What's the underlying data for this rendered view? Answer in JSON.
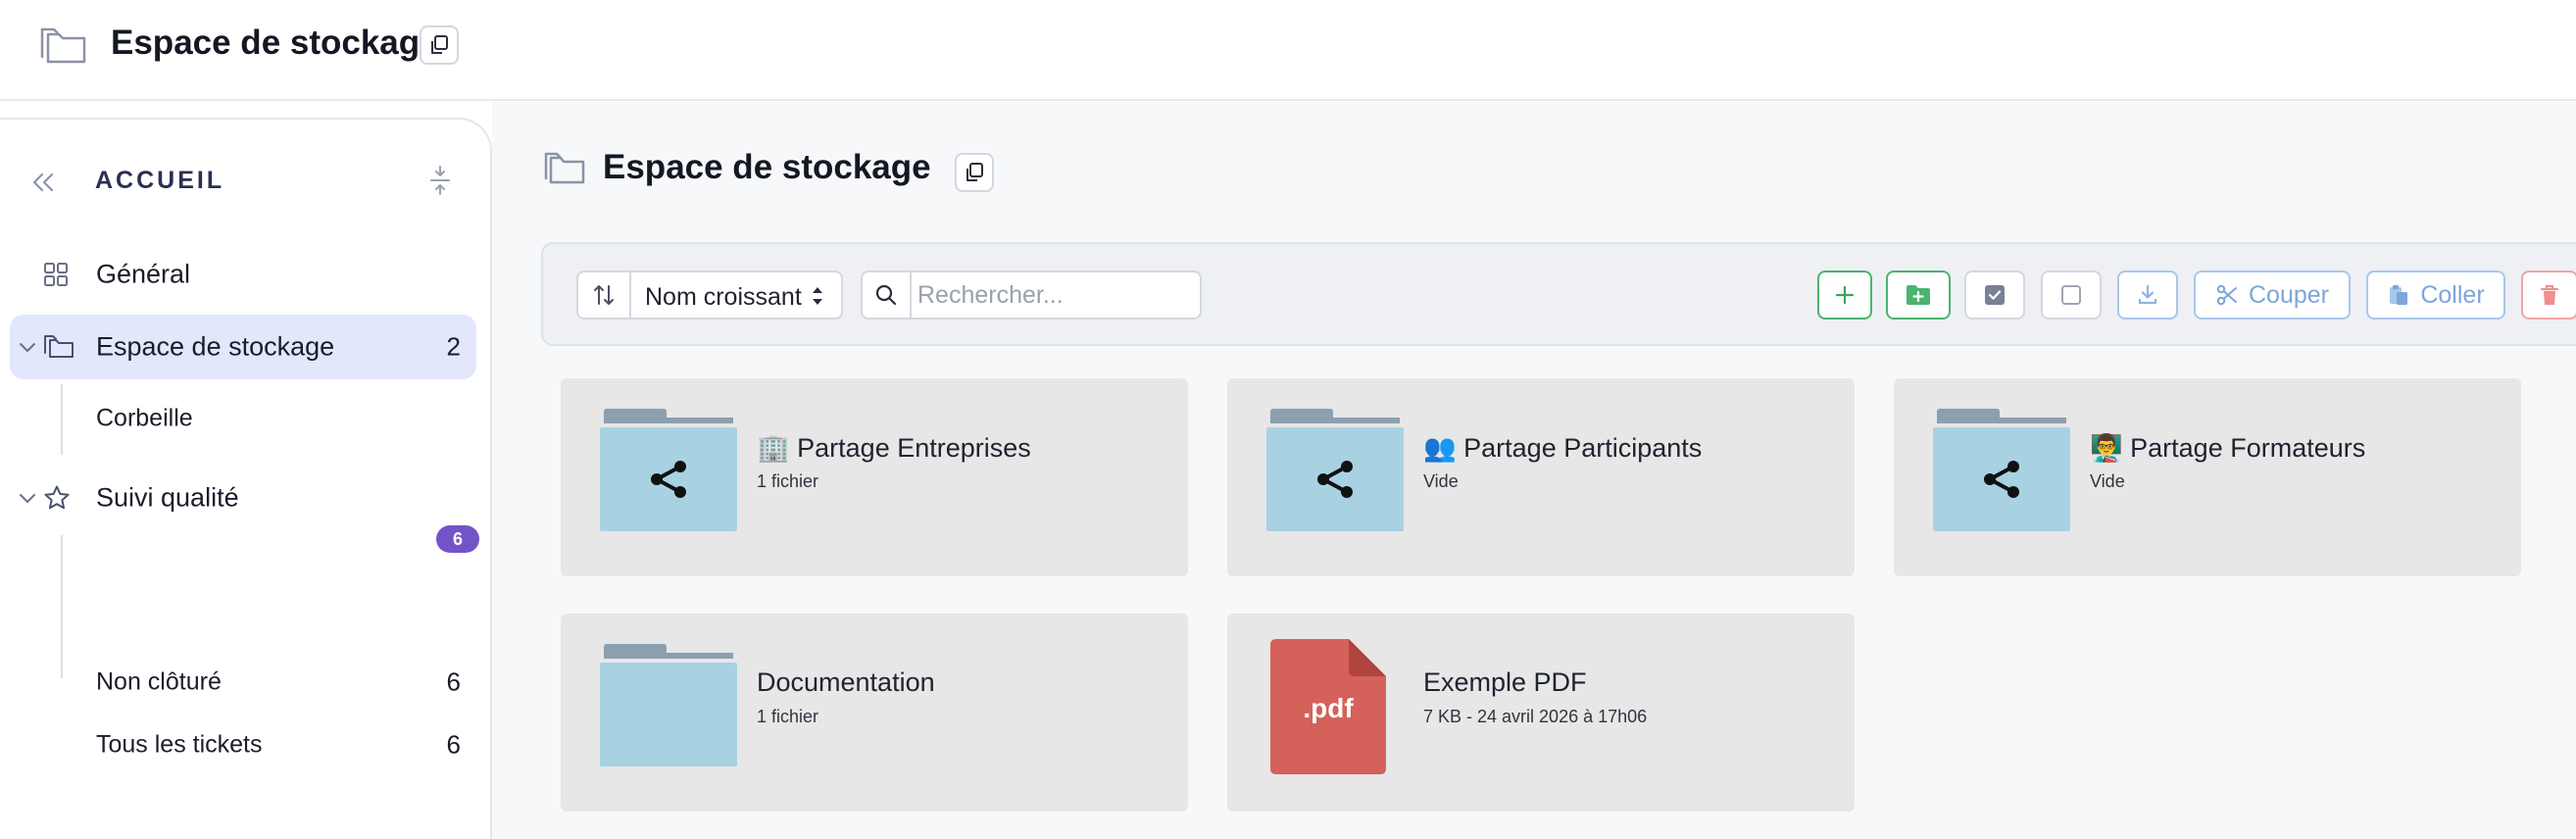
{
  "header": {
    "title": "Espace de stockage"
  },
  "sidebar": {
    "section_title": "ACCUEIL",
    "items": [
      {
        "label": "Général",
        "icon": "grid-icon"
      },
      {
        "label": "Espace de stockage",
        "icon": "folder-icon",
        "count": "2",
        "expanded": true,
        "active": true
      },
      {
        "label": "Corbeille"
      },
      {
        "label": "Suivi qualité",
        "icon": "star-icon",
        "expanded": true
      },
      {
        "label": "Non clôturé",
        "count": "6",
        "badge": "6"
      },
      {
        "label": "Tous les tickets",
        "count": "6"
      }
    ]
  },
  "main": {
    "title": "Espace de stockage",
    "toolbar": {
      "sort_value": "Nom croissant",
      "search_placeholder": "Rechercher...",
      "cut_label": "Couper",
      "paste_label": "Coller"
    },
    "cards": [
      {
        "emoji": "🏢",
        "name": "Partage Entreprises",
        "meta": "1 fichier",
        "type": "shared-folder"
      },
      {
        "emoji": "👥",
        "name": "Partage Participants",
        "meta": "Vide",
        "type": "shared-folder"
      },
      {
        "emoji": "👨‍🏫",
        "name": "Partage Formateurs",
        "meta": "Vide",
        "type": "shared-folder"
      },
      {
        "name": "Documentation",
        "meta": "1 fichier",
        "type": "folder"
      },
      {
        "name": "Exemple PDF",
        "meta": "7 KB - 24 avril 2026 à 17h06",
        "type": "pdf",
        "ext_label": ".pdf"
      }
    ]
  },
  "colors": {
    "accent_purple": "#7353c8",
    "active_bg": "#e2e7fc",
    "folder_body": "#a8d2e2",
    "folder_tab": "#8a9eae",
    "pdf_red": "#d4615a",
    "green": "#4bb46f"
  }
}
